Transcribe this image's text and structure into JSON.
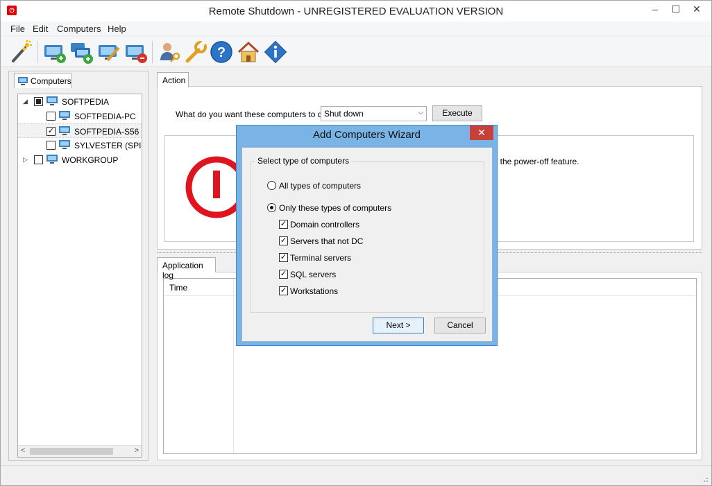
{
  "window": {
    "title": "Remote Shutdown - UNREGISTERED EVALUATION VERSION",
    "app_icon": "power-app-icon",
    "minimize": "–",
    "maximize": "☐",
    "close": "✕"
  },
  "menu": [
    "File",
    "Edit",
    "Computers",
    "Help"
  ],
  "toolbar": {
    "buttons": [
      "wizard-icon",
      "add-computer-icon",
      "add-group-icon",
      "edit-computer-icon",
      "remove-computer-icon",
      "user-key-icon",
      "wrench-icon",
      "help-icon",
      "home-icon",
      "info-icon"
    ]
  },
  "left_panel": {
    "tab": "Computers",
    "tree": [
      {
        "label": "SOFTPEDIA",
        "level": 0,
        "expander": "◢",
        "check": "partial"
      },
      {
        "label": "SOFTPEDIA-PC",
        "level": 1,
        "check": ""
      },
      {
        "label": "SOFTPEDIA-S56",
        "level": 1,
        "check": "✓",
        "selected": true
      },
      {
        "label": "SYLVESTER (SPIS",
        "level": 1,
        "check": ""
      },
      {
        "label": "WORKGROUP",
        "level": 0,
        "expander": "▷",
        "check": ""
      }
    ],
    "scroll_left": "<",
    "scroll_right": ">"
  },
  "action": {
    "tab": "Action",
    "question": "What do you want these computers to do:",
    "selected_action": "Shut down",
    "execute_label": "Execute",
    "info_text": "t the power-off feature."
  },
  "log": {
    "tab": "Application log",
    "columns": [
      "Time"
    ]
  },
  "dialog": {
    "title": "Add Computers Wizard",
    "close": "✕",
    "group_label": "Select type of computers",
    "radio_all": "All types of computers",
    "radio_only": "Only these types of computers",
    "types": [
      {
        "label": "Domain controllers",
        "check": "✓"
      },
      {
        "label": "Servers that not DC",
        "check": "✓"
      },
      {
        "label": "Terminal servers",
        "check": "✓"
      },
      {
        "label": "SQL servers",
        "check": "✓"
      },
      {
        "label": "Workstations",
        "check": "✓"
      }
    ],
    "next_label": "Next >",
    "cancel_label": "Cancel"
  },
  "colors": {
    "accent": "#3d87cc",
    "power_red": "#e0141e",
    "dialog_frame": "#7ab4e6"
  }
}
